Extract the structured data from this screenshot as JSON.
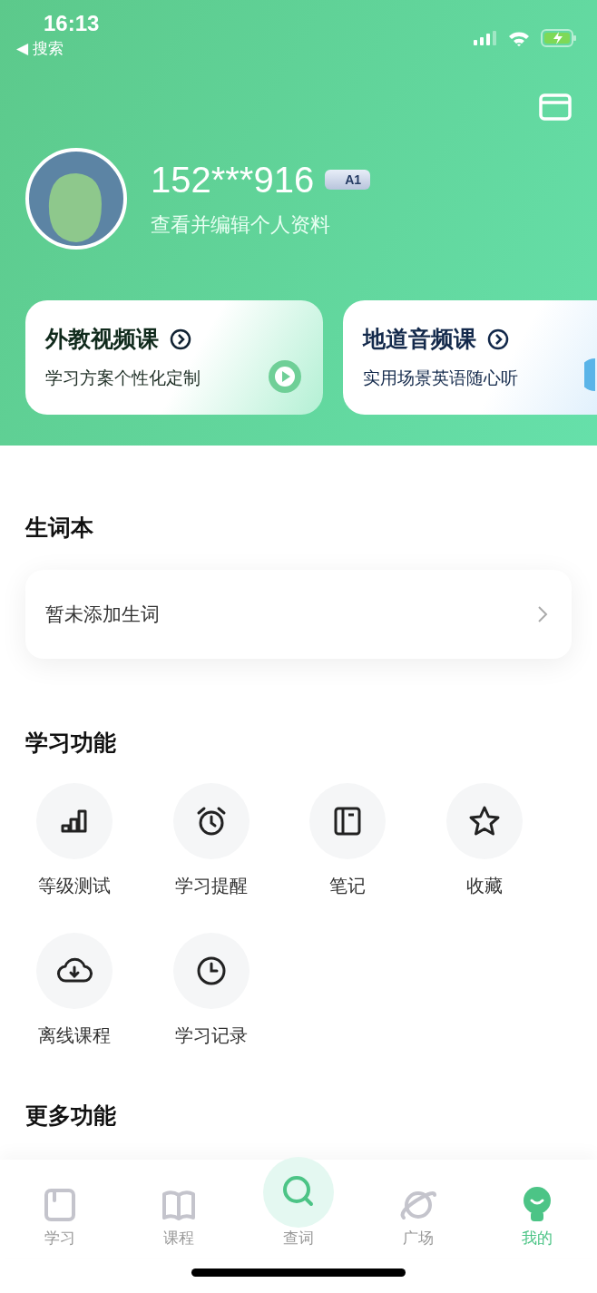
{
  "status_bar": {
    "time": "16:13",
    "back_label": "◀ 搜索"
  },
  "profile": {
    "phone": "152***916",
    "level_badge": "A1",
    "subtitle": "查看并编辑个人资料"
  },
  "promo_cards": [
    {
      "title": "外教视频课",
      "subtitle": "学习方案个性化定制",
      "kind": "video"
    },
    {
      "title": "地道音频课",
      "subtitle": "实用场景英语随心听",
      "kind": "audio"
    }
  ],
  "vocab": {
    "title": "生词本",
    "entry": "暂未添加生词"
  },
  "features": {
    "title": "学习功能",
    "items": [
      {
        "label": "等级测试",
        "kind": "chart"
      },
      {
        "label": "学习提醒",
        "kind": "alarm"
      },
      {
        "label": "笔记",
        "kind": "note"
      },
      {
        "label": "收藏",
        "kind": "star"
      },
      {
        "label": "离线课程",
        "kind": "download"
      },
      {
        "label": "学习记录",
        "kind": "clock"
      }
    ]
  },
  "more": {
    "title": "更多功能"
  },
  "tab_bar": [
    {
      "label": "学习",
      "kind": "study",
      "selected": false
    },
    {
      "label": "课程",
      "kind": "course",
      "selected": false
    },
    {
      "label": "查词",
      "kind": "search",
      "selected": false
    },
    {
      "label": "广场",
      "kind": "plaza",
      "selected": false
    },
    {
      "label": "我的",
      "kind": "me",
      "selected": true
    }
  ]
}
